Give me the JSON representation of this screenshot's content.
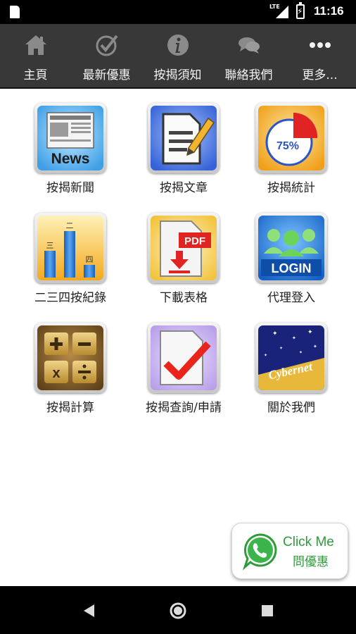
{
  "status_bar": {
    "network": "LTE",
    "time": "11:16"
  },
  "nav": [
    {
      "label": "主頁",
      "icon": "home-icon"
    },
    {
      "label": "最新優惠",
      "icon": "checkmark-circle-icon"
    },
    {
      "label": "按揭須知",
      "icon": "info-icon"
    },
    {
      "label": "聯絡我們",
      "icon": "chat-bubbles-icon"
    },
    {
      "label": "更多...",
      "icon": "more-dots-icon"
    }
  ],
  "tiles": [
    {
      "label": "按揭新聞",
      "icon": "news-icon",
      "icon_text": "News"
    },
    {
      "label": "按揭文章",
      "icon": "document-edit-icon"
    },
    {
      "label": "按揭統計",
      "icon": "pie-chart-icon",
      "icon_text": "75%"
    },
    {
      "label": "二三四按紀錄",
      "icon": "bar-chart-icon"
    },
    {
      "label": "下載表格",
      "icon": "pdf-download-icon",
      "icon_text": "PDF"
    },
    {
      "label": "代理登入",
      "icon": "login-icon",
      "icon_text": "LOGIN"
    },
    {
      "label": "按揭計算",
      "icon": "calculator-icon"
    },
    {
      "label": "按揭查詢/申請",
      "icon": "checklist-icon"
    },
    {
      "label": "關於我們",
      "icon": "cybernet-logo-icon",
      "icon_text": "Cybernet"
    }
  ],
  "whatsapp": {
    "line1": "Click Me",
    "line2": "問優惠"
  },
  "colors": {
    "nav_bg": "#383838",
    "whatsapp_green": "#2e9b3a",
    "check_red": "#e8241c"
  }
}
